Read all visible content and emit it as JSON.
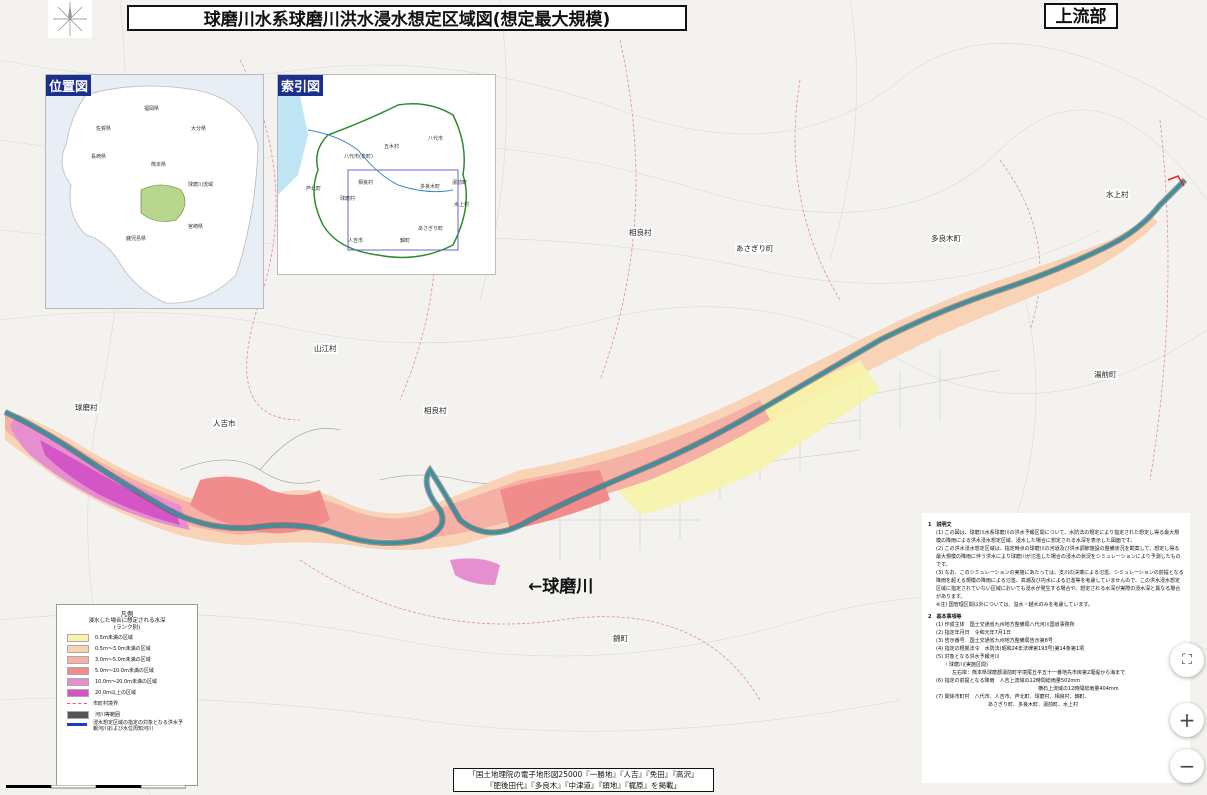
{
  "title": "球磨川水系球磨川洪水浸水想定区域図(想定最大規模)",
  "section": "上流部",
  "location_map": {
    "header": "位置図",
    "labels": [
      "福岡県",
      "大分県",
      "佐賀県",
      "長崎県",
      "熊本県",
      "球磨川流域",
      "宮崎県",
      "鹿児島県"
    ]
  },
  "index_map": {
    "header": "索引図",
    "labels": [
      "八代市",
      "五木村",
      "八代市(泉町)",
      "人吉市",
      "球磨村",
      "相良村",
      "芦北町",
      "湯前町",
      "多良木町",
      "水上村",
      "あさぎり町",
      "錦町"
    ]
  },
  "places": {
    "kuma_village": "球磨村",
    "hitoyoshi": "人吉市",
    "yamae": "山江村",
    "sagara": "相良村",
    "sagara2": "相良村",
    "nishiki": "錦町",
    "asagiri": "あさぎり町",
    "taragi": "多良木町",
    "yunomae": "湯前町",
    "mizukami": "水上村",
    "kawabe": "相良村"
  },
  "river_label": "←球磨川",
  "legend": {
    "title": "凡例",
    "subtitle": "浸水した場合に想定される水深",
    "subtitle2": "(ランク別)",
    "items": [
      {
        "label": "0.5m未満の区域",
        "color": "#f7f3a9"
      },
      {
        "label": "0.5m〜3.0m未満の区域",
        "color": "#f8d3b6"
      },
      {
        "label": "3.0m〜5.0m未満の区域",
        "color": "#f6b1a6"
      },
      {
        "label": "5.0m〜10.0m未満の区域",
        "color": "#f08c8c"
      },
      {
        "label": "10.0m〜20.0m未満の区域",
        "color": "#e58fd0"
      },
      {
        "label": "20.0m以上の区域",
        "color": "#d455c6"
      }
    ],
    "boundary": "市町村境界",
    "river_area": "河川等範囲",
    "target": "浸水想定区域の指定の対象となる洪水予報河川および水位周知河川"
  },
  "notes": {
    "h1": "1　説明文",
    "p1": "(1) この図は、球磨川水系球磨川の洪水予報区間について、水防法の規定により指定された想定し得る最大規模の降雨による洪水浸水想定区域、浸水した場合に想定される水深を表示した図面です。",
    "p2": "(2) この洪水浸水想定区域は、指定時点の球磨川の河道及び洪水調節施設の整備状況を勘案して、想定し得る最大規模の降雨に伴う洪水により球磨川が氾濫した場合の浸水の状況をシミュレーションにより予測したものです。",
    "p3": "(3) なお、このシミュレーションの実施にあたっては、支川の決壊による氾濫、シミュレーションの前提となる降雨を超える規模の降雨による氾濫、高潮及び内水による氾濫等を考慮していませんので、この洪水浸水想定区域に指定されていない区域においても浸水が発生する場合や、想定される水深が実際の浸水深と異なる場合があります。",
    "p4": "※注) 国管理区間以外については、溢水・越水のみを考慮しています。",
    "h2": "2　基本事項等",
    "b1": "(1) 作成主体　国土交通省九州地方整備局八代河川国道事務所",
    "b2": "(2) 指定年月日　令和元年7月1日",
    "b3": "(3) 告示番号　国土交通省九州地方整備局告示第8号",
    "b4": "(4) 指定の根拠法令　水防法(昭和24年法律第193号)第14条第1項",
    "b5": "(5) 対象となる洪水予報河川",
    "b5a": "・球磨川(実施区間)",
    "b5b": "左右岸：熊本県球磨郡湯前町字境尾丘平五十一番地先市房第2堰堤から海まで",
    "b6": "(6) 指定の前提となる降雨　人吉上流域の12時間総雨量502mm",
    "b6a": "横石上流域の12時間総雨量404mm",
    "b7": "(7) 関係市町村　八代市、人吉市、芦北町、球磨村、相良村、錦町、",
    "b7a": "あさぎり町、多良木町、湯前町、水上村"
  },
  "credit_line1": "「国土地理院の電子地形図25000『一勝地』『人吉』『免田』『高沢』",
  "credit_line2": "『肥後田代』『多良木』『中津道』『頭地』『梶原』を掲載」",
  "controls": {
    "fullscreen": "⛶",
    "zoom_in": "+",
    "zoom_out": "−"
  },
  "colors": {
    "river": "#3e8fa0",
    "river_area": "#555555",
    "boundary": "#e05a7a",
    "target_line": "#1a3fc4"
  }
}
